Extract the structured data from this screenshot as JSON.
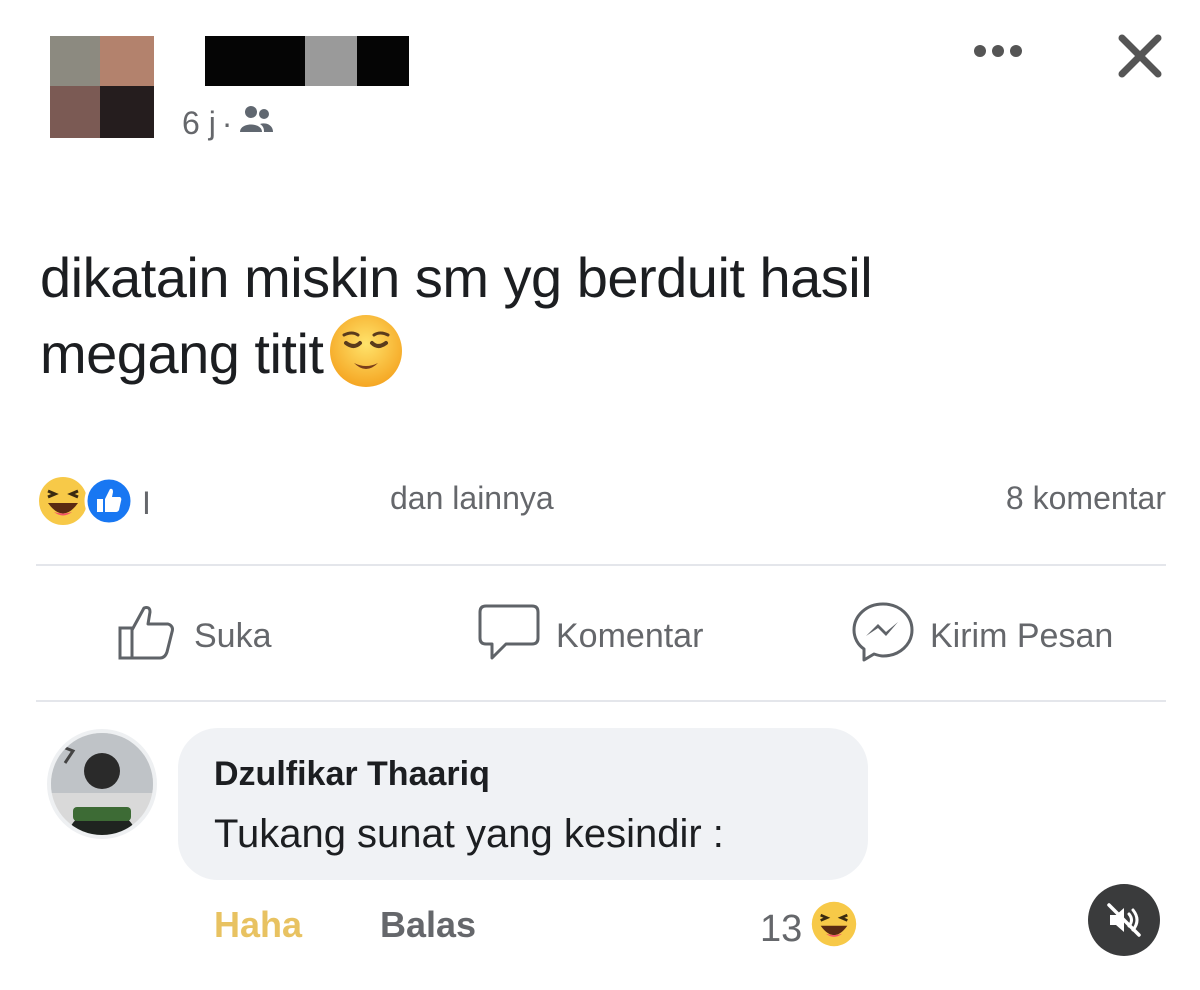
{
  "post": {
    "meta_time": "6 j",
    "meta_sep": "·",
    "text_line1": "dikatain miskin sm yg berduit hasil",
    "text_line2": "megang titit",
    "reactions_count_glyph": "I",
    "reactions_more": "dan lainnya",
    "comments_count": "8 komentar"
  },
  "actions": {
    "like": "Suka",
    "comment": "Komentar",
    "send": "Kirim Pesan"
  },
  "comment": {
    "author": "Dzulfikar Thaariq",
    "text": "Tukang sunat yang kesindir :",
    "reaction_label": "Haha",
    "reply_label": "Balas",
    "reaction_count": "13"
  },
  "icons": {
    "more": "more-horizontal-icon",
    "close": "close-icon",
    "audience": "friends-icon",
    "post_emoji": "relieved-face-emoji",
    "haha": "haha-reaction-icon",
    "like": "like-reaction-icon",
    "mute": "speaker-muted-icon"
  },
  "colors": {
    "text": "#1c1e21",
    "secondary": "#65676b",
    "bubble": "#f0f2f5",
    "haha_active": "#e8c261",
    "like_blue": "#1877f2"
  }
}
